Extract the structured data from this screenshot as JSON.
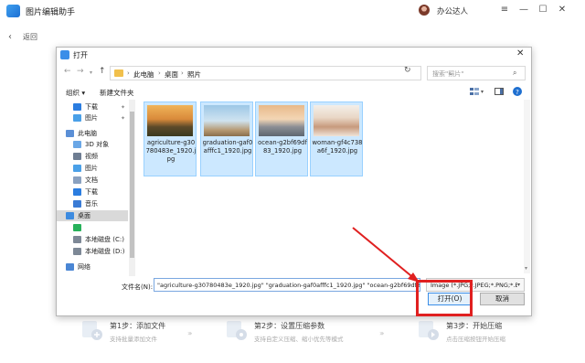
{
  "app": {
    "title": "图片编辑助手",
    "user_name": "办公达人",
    "back_label": "返回",
    "minimize": "—",
    "maximize": "☐",
    "close": "✕"
  },
  "dialog": {
    "title": "打开",
    "close": "✕",
    "breadcrumb": [
      "此电脑",
      "桌面",
      "照片"
    ],
    "search_placeholder": "搜索\"照片\"",
    "toolbar": {
      "organize": "组织 ▾",
      "new_folder": "新建文件夹"
    },
    "nav": [
      {
        "label": "下载",
        "pinned": true,
        "icon": "download-icon",
        "selected": false
      },
      {
        "label": "图片",
        "pinned": true,
        "icon": "pictures-icon",
        "selected": false
      },
      {
        "label": "此电脑",
        "pinned": false,
        "icon": "computer-icon",
        "selected": false
      },
      {
        "label": "3D 对象",
        "pinned": false,
        "icon": "3d-objects-icon",
        "selected": false
      },
      {
        "label": "视频",
        "pinned": false,
        "icon": "video-icon",
        "selected": false
      },
      {
        "label": "图片",
        "pinned": false,
        "icon": "pictures-icon",
        "selected": false
      },
      {
        "label": "文档",
        "pinned": false,
        "icon": "documents-icon",
        "selected": false
      },
      {
        "label": "下载",
        "pinned": false,
        "icon": "download-icon",
        "selected": false
      },
      {
        "label": "音乐",
        "pinned": false,
        "icon": "music-icon",
        "selected": false
      },
      {
        "label": "桌面",
        "pinned": false,
        "icon": "desktop-icon",
        "selected": true
      },
      {
        "label": "",
        "pinned": false,
        "icon": "app-icon",
        "selected": false
      },
      {
        "label": "本地磁盘 (C:)",
        "pinned": false,
        "icon": "drive-icon",
        "selected": false
      },
      {
        "label": "本地磁盘 (D:)",
        "pinned": false,
        "icon": "drive-icon",
        "selected": false
      },
      {
        "label": "网络",
        "pinned": false,
        "icon": "network-icon",
        "selected": false
      }
    ],
    "files": [
      {
        "name": "agriculture-g30780483e_1920.jpg"
      },
      {
        "name": "graduation-gaf0afffc1_1920.jpg"
      },
      {
        "name": "ocean-g2bf69df83_1920.jpg"
      },
      {
        "name": "woman-gf4c738a6f_1920.jpg"
      }
    ],
    "filename_label": "文件名(N):",
    "filename_value": "\"agriculture-g30780483e_1920.jpg\" \"graduation-gaf0afffc1_1920.jpg\" \"ocean-g2bf69df8",
    "filetype_value": "Image (*.JPG;*.JPEG;*.PNG;*.B",
    "open_button": "打开(O)",
    "cancel_button": "取消"
  },
  "steps": [
    {
      "title": "第1步：添加文件",
      "desc": "支持批量添加文件"
    },
    {
      "title": "第2步：设置压缩参数",
      "desc": "支持自定义压缩、缩小优先等模式"
    },
    {
      "title": "第3步：开始压缩",
      "desc": "点击压缩按钮开始压缩"
    }
  ],
  "colors": {
    "accent": "#3b8ee8",
    "annotation": "#e02020",
    "selection": "#cce8ff"
  }
}
